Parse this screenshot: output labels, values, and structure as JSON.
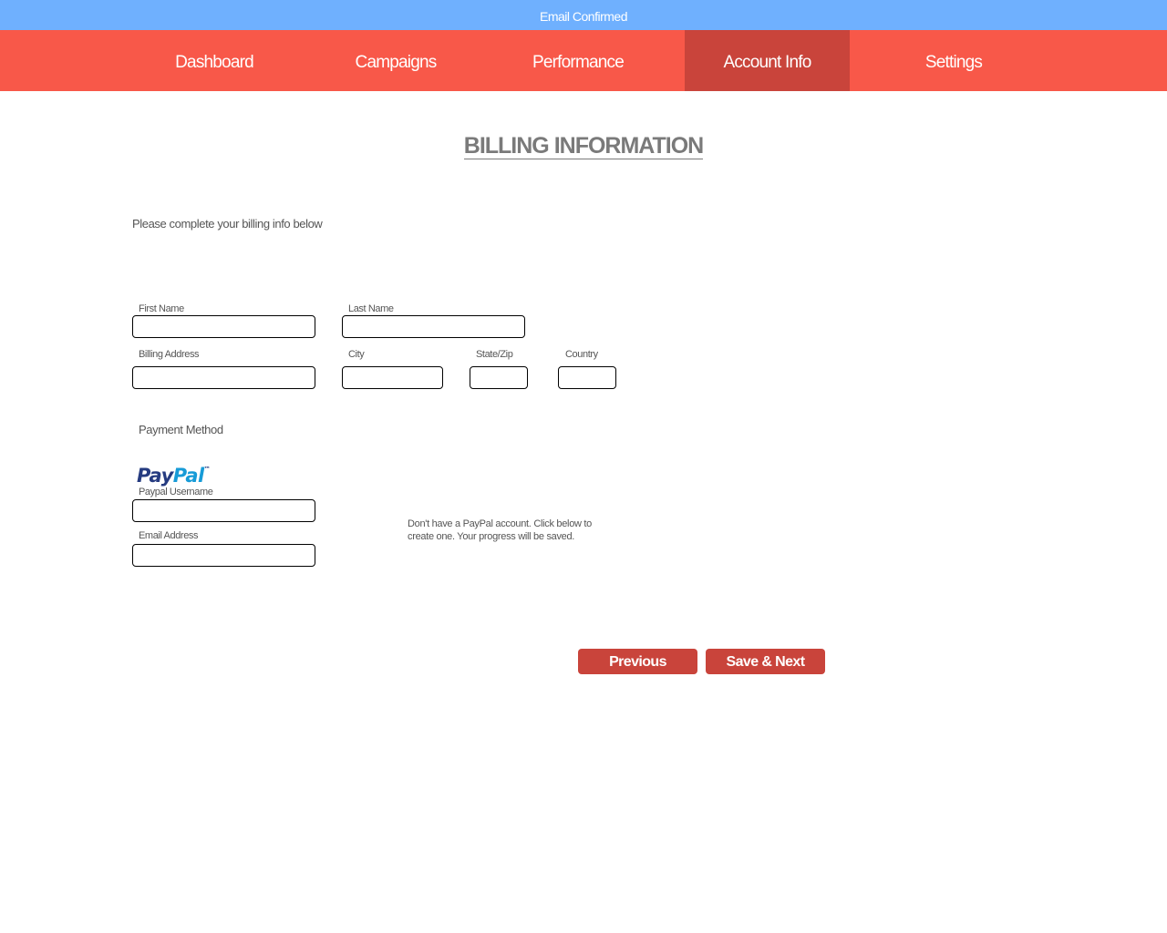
{
  "banner": {
    "text": "Email Confirmed"
  },
  "nav": {
    "tabs": [
      {
        "label": "Dashboard"
      },
      {
        "label": "Campaigns"
      },
      {
        "label": "Performance"
      },
      {
        "label": "Account Info",
        "active": true
      },
      {
        "label": "Settings"
      }
    ]
  },
  "page": {
    "title": "BILLING INFORMATION",
    "intro": "Please complete your billing info below"
  },
  "form": {
    "first_name_label": "First Name",
    "first_name_value": "",
    "last_name_label": "Last Name",
    "last_name_value": "",
    "billing_address_label": "Billing Address",
    "billing_address_value": "",
    "city_label": "City",
    "city_value": "",
    "state_zip_label": "State/Zip",
    "state_zip_value": "",
    "country_label": "Country",
    "country_value": ""
  },
  "payment": {
    "section_label": "Payment Method",
    "logo_part1": "Pay",
    "logo_part2": "Pal",
    "logo_tm": "™",
    "username_label": "Paypal Username",
    "username_value": "",
    "email_label": "Email Address",
    "email_value": "",
    "note": "Don't have a PayPal account. Click below to create one. Your progress will be saved."
  },
  "actions": {
    "previous_label": "Previous",
    "save_next_label": "Save & Next"
  },
  "colors": {
    "banner": "#6fb0fe",
    "nav": "#f85849",
    "nav_active": "#c9443b",
    "button": "#c9443b",
    "paypal_dark": "#253b80",
    "paypal_light": "#179bd7"
  }
}
